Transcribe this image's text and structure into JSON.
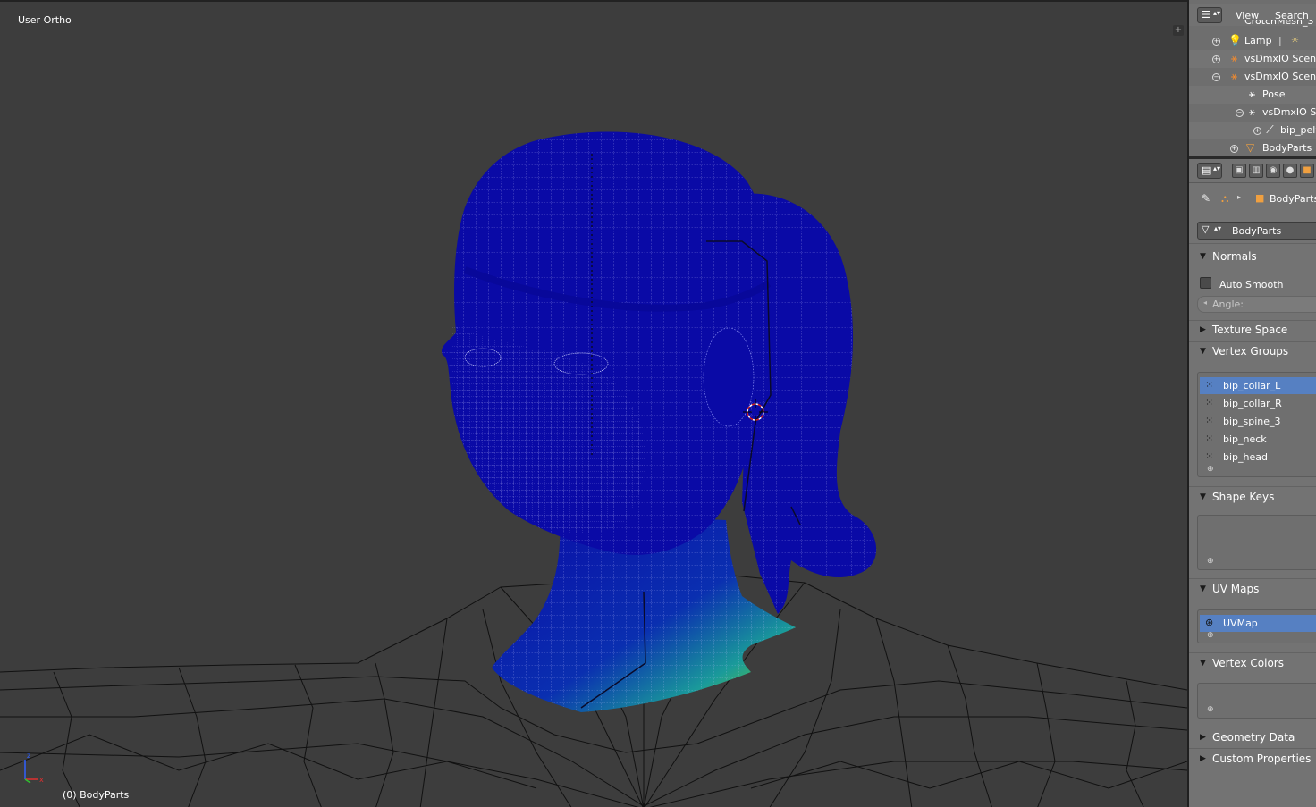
{
  "viewport": {
    "title": "User Ortho",
    "object_label": "(0) BodyParts"
  },
  "outliner": {
    "header": {
      "view_menu": "View",
      "search_menu": "Search"
    },
    "rows": [
      {
        "label": "CrotchMesh_3",
        "icon": "mesh-icon"
      },
      {
        "label": "Lamp",
        "icon": "lamp-icon"
      },
      {
        "label": "vsDmxIO Scene",
        "icon": "armature-icon"
      },
      {
        "label": "vsDmxIO Scene.",
        "icon": "armature-icon"
      },
      {
        "label": "Pose",
        "icon": "pose-icon"
      },
      {
        "label": "vsDmxIO Sc",
        "icon": "armature-data-icon"
      },
      {
        "label": "bip_pelv",
        "icon": "bone-icon"
      },
      {
        "label": "BodyParts",
        "icon": "mesh-object-icon"
      }
    ]
  },
  "properties": {
    "breadcrumb": {
      "object": "BodyParts"
    },
    "mesh_name": "BodyParts",
    "normals": {
      "title": "Normals",
      "auto_smooth_label": "Auto Smooth",
      "angle_label": "Angle:"
    },
    "panels": {
      "texture_space": "Texture Space",
      "vertex_groups": "Vertex Groups",
      "shape_keys": "Shape Keys",
      "uv_maps": "UV Maps",
      "vertex_colors": "Vertex Colors",
      "geometry_data": "Geometry Data",
      "custom_properties": "Custom Properties"
    },
    "vertex_groups": [
      "bip_collar_L",
      "bip_collar_R",
      "bip_spine_3",
      "bip_neck",
      "bip_head"
    ],
    "uv_maps": [
      "UVMap"
    ]
  },
  "colors": {
    "viewport_bg": "#3d3d3d",
    "mesh_blue": "#0a0aa6",
    "mesh_green": "#6fe010",
    "selection": "#5680c2"
  }
}
